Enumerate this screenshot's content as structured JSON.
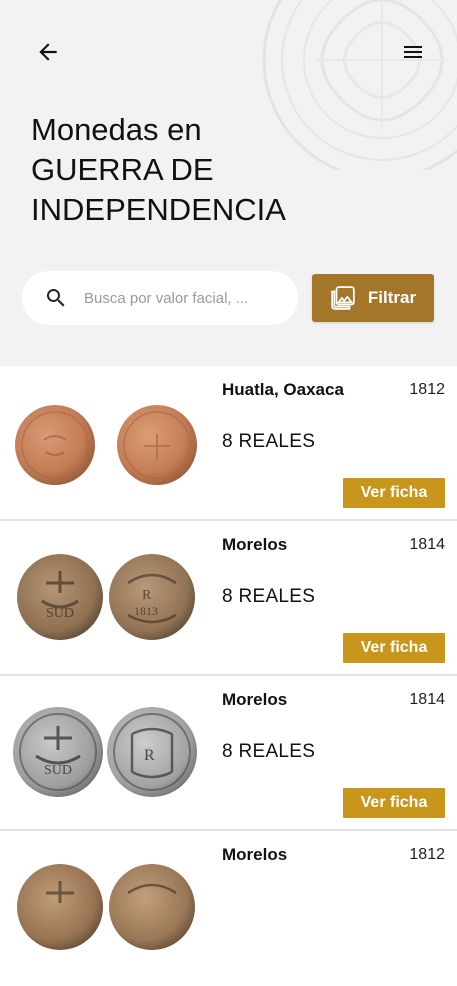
{
  "header": {
    "title_lines": [
      "Monedas en",
      "GUERRA DE",
      "INDEPENDENCIA"
    ]
  },
  "search": {
    "placeholder": "Busca por valor facial, ..."
  },
  "filter": {
    "label": "Filtrar"
  },
  "colors": {
    "accent_filter": "#a4762a",
    "accent_button": "#c9961c",
    "header_bg": "#f2f2f2"
  },
  "icons": {
    "back": "arrow-back-icon",
    "menu": "hamburger-menu-icon",
    "search": "search-icon",
    "filter": "image-gallery-icon"
  },
  "items": [
    {
      "place": "Huatla, Oaxaca",
      "year": "1812",
      "denomination": "8 REALES",
      "action": "Ver ficha",
      "tone": "copper"
    },
    {
      "place": "Morelos",
      "year": "1814",
      "denomination": "8 REALES",
      "action": "Ver ficha",
      "tone": "bronze"
    },
    {
      "place": "Morelos",
      "year": "1814",
      "denomination": "8 REALES",
      "action": "Ver ficha",
      "tone": "silver"
    },
    {
      "place": "Morelos",
      "year": "1812",
      "denomination": "",
      "action": "",
      "tone": "bronze"
    }
  ]
}
